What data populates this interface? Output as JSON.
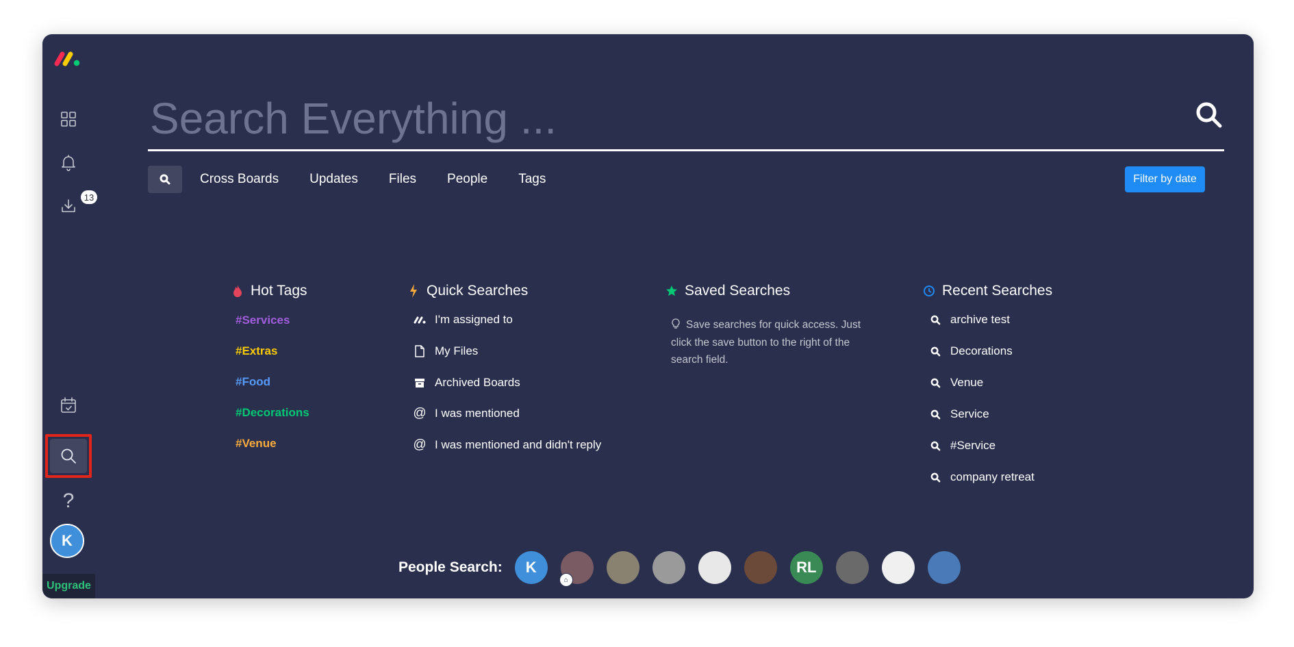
{
  "sidebar": {
    "inbox_badge": "13",
    "help_label": "?",
    "avatar_initial": "K",
    "upgrade_label": "Upgrade"
  },
  "search": {
    "placeholder": "Search Everything ...",
    "value": ""
  },
  "tabs": [
    "Cross Boards",
    "Updates",
    "Files",
    "People",
    "Tags"
  ],
  "filter_button": "Filter by date",
  "hot_tags": {
    "title": "Hot Tags",
    "items": [
      {
        "label": "#Services",
        "color": "#a25ddc"
      },
      {
        "label": "#Extras",
        "color": "#ffcb00"
      },
      {
        "label": "#Food",
        "color": "#579bfc"
      },
      {
        "label": "#Decorations",
        "color": "#00c875"
      },
      {
        "label": "#Venue",
        "color": "#fdab3d"
      }
    ]
  },
  "quick_searches": {
    "title": "Quick Searches",
    "items": [
      {
        "label": "I'm assigned to",
        "icon": "monday-logo-icon"
      },
      {
        "label": "My Files",
        "icon": "file-icon"
      },
      {
        "label": "Archived Boards",
        "icon": "archive-icon"
      },
      {
        "label": "I was mentioned",
        "icon": "at-icon"
      },
      {
        "label": "I was mentioned and didn't reply",
        "icon": "at-icon"
      }
    ]
  },
  "saved_searches": {
    "title": "Saved Searches",
    "hint": "Save searches for quick access. Just click the save button to the right of the search field."
  },
  "recent_searches": {
    "title": "Recent Searches",
    "items": [
      "archive test",
      "Decorations",
      "Venue",
      "Service",
      "#Service",
      "company retreat"
    ]
  },
  "people_search": {
    "label": "People Search:",
    "people": [
      {
        "initials": "K",
        "color": "#3f8fdb"
      },
      {
        "initials": "",
        "color": "#7a5a63"
      },
      {
        "initials": "",
        "color": "#8a8270"
      },
      {
        "initials": "",
        "color": "#9a9a9a"
      },
      {
        "initials": "",
        "color": "#e8e8e8"
      },
      {
        "initials": "",
        "color": "#6b4a3a"
      },
      {
        "initials": "RL",
        "color": "#3a8a55"
      },
      {
        "initials": "",
        "color": "#6a6a6a"
      },
      {
        "initials": "",
        "color": "#f0f0f0"
      },
      {
        "initials": "",
        "color": "#4a7ab8"
      }
    ]
  },
  "colors": {
    "background": "#292f4c",
    "accent": "#1f8bf5",
    "upgrade": "#2fc27a",
    "highlight": "#e1251b"
  }
}
